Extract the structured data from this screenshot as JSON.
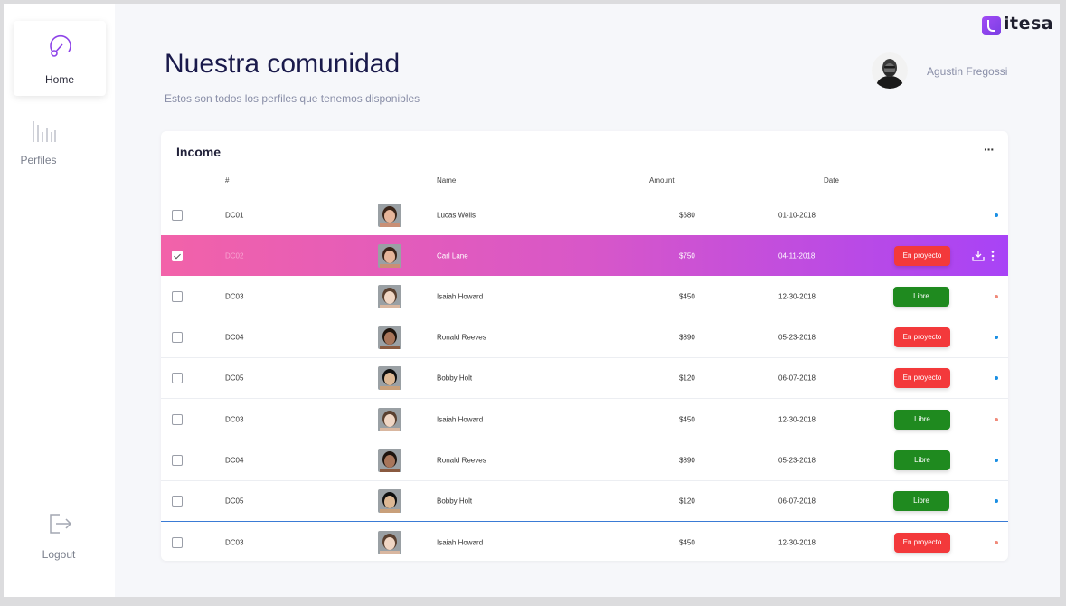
{
  "sidebar": {
    "home_label": "Home",
    "perfiles_label": "Perfiles",
    "logout_label": "Logout"
  },
  "header": {
    "title": "Nuestra comunidad",
    "subtitle": "Estos son todos los perfiles que tenemos disponibles",
    "logo_text": "itesa",
    "user_name": "Agustin Fregossi"
  },
  "card": {
    "title": "Income",
    "more_label": "···",
    "columns": {
      "code": "#",
      "name": "Name",
      "amount": "Amount",
      "date": "Date"
    }
  },
  "colors": {
    "accent_purple": "#a843f6",
    "accent_pink": "#f262a9",
    "status_red": "#f3393b",
    "status_green": "#1f8a1f",
    "dot_blue": "#1a8fe3",
    "dot_salmon": "#f08a7a"
  },
  "rows": [
    {
      "code": "DC01",
      "name": "Lucas Wells",
      "amount": "$680",
      "date": "01-10-2018",
      "status": "",
      "dot": "blue",
      "selected": false,
      "face": "woman"
    },
    {
      "code": "DC02",
      "name": "Carl Lane",
      "amount": "$750",
      "date": "04-11-2018",
      "status": "En proyecto",
      "dot": "",
      "selected": true,
      "face": "woman"
    },
    {
      "code": "DC03",
      "name": "Isaiah Howard",
      "amount": "$450",
      "date": "12-30-2018",
      "status": "Libre",
      "dot": "salmon",
      "selected": false,
      "face": "man-light"
    },
    {
      "code": "DC04",
      "name": "Ronald Reeves",
      "amount": "$890",
      "date": "05-23-2018",
      "status": "En proyecto",
      "dot": "blue",
      "selected": false,
      "face": "man-dark"
    },
    {
      "code": "DC05",
      "name": "Bobby Holt",
      "amount": "$120",
      "date": "06-07-2018",
      "status": "En proyecto",
      "dot": "blue",
      "selected": false,
      "face": "man-asian"
    },
    {
      "code": "DC03",
      "name": "Isaiah Howard",
      "amount": "$450",
      "date": "12-30-2018",
      "status": "Libre",
      "dot": "salmon",
      "selected": false,
      "face": "man-light"
    },
    {
      "code": "DC04",
      "name": "Ronald Reeves",
      "amount": "$890",
      "date": "05-23-2018",
      "status": "Libre",
      "dot": "blue",
      "selected": false,
      "face": "man-dark"
    },
    {
      "code": "DC05",
      "name": "Bobby Holt",
      "amount": "$120",
      "date": "06-07-2018",
      "status": "Libre",
      "dot": "blue",
      "selected": false,
      "face": "man-asian"
    },
    {
      "code": "DC03",
      "name": "Isaiah Howard",
      "amount": "$450",
      "date": "12-30-2018",
      "status": "En proyecto",
      "dot": "salmon",
      "selected": false,
      "face": "man-light"
    }
  ]
}
